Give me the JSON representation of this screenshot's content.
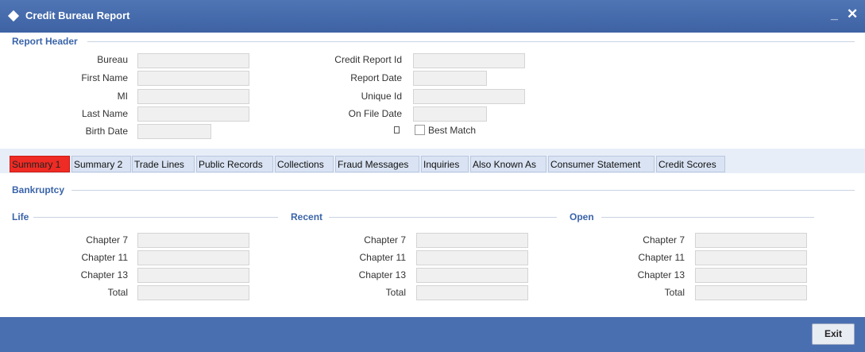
{
  "window": {
    "title": "Credit Bureau Report",
    "minimize_glyph": "_",
    "close_glyph": "✕"
  },
  "report_header": {
    "title": "Report Header",
    "bureau_label": "Bureau",
    "first_name_label": "First Name",
    "mi_label": "MI",
    "last_name_label": "Last Name",
    "birth_date_label": "Birth Date",
    "credit_report_id_label": "Credit Report Id",
    "report_date_label": "Report Date",
    "unique_id_label": "Unique Id",
    "on_file_date_label": "On File Date",
    "best_match_label": "Best Match"
  },
  "tabs": [
    {
      "label": "Summary 1"
    },
    {
      "label": "Summary 2"
    },
    {
      "label": "Trade Lines"
    },
    {
      "label": "Public Records"
    },
    {
      "label": "Collections"
    },
    {
      "label": "Fraud Messages"
    },
    {
      "label": "Inquiries"
    },
    {
      "label": "Also Known As"
    },
    {
      "label": "Consumer Statement"
    },
    {
      "label": "Credit Scores"
    }
  ],
  "bankruptcy": {
    "title": "Bankruptcy",
    "groups": [
      {
        "title": "Life"
      },
      {
        "title": "Recent"
      },
      {
        "title": "Open"
      }
    ],
    "row_labels": [
      "Chapter 7",
      "Chapter 11",
      "Chapter 13",
      "Total"
    ]
  },
  "footer": {
    "exit_label": "Exit"
  },
  "colors": {
    "titlebar": "#4a6fb0",
    "active_tab": "#ee2b24",
    "section_text": "#3a64a8"
  }
}
